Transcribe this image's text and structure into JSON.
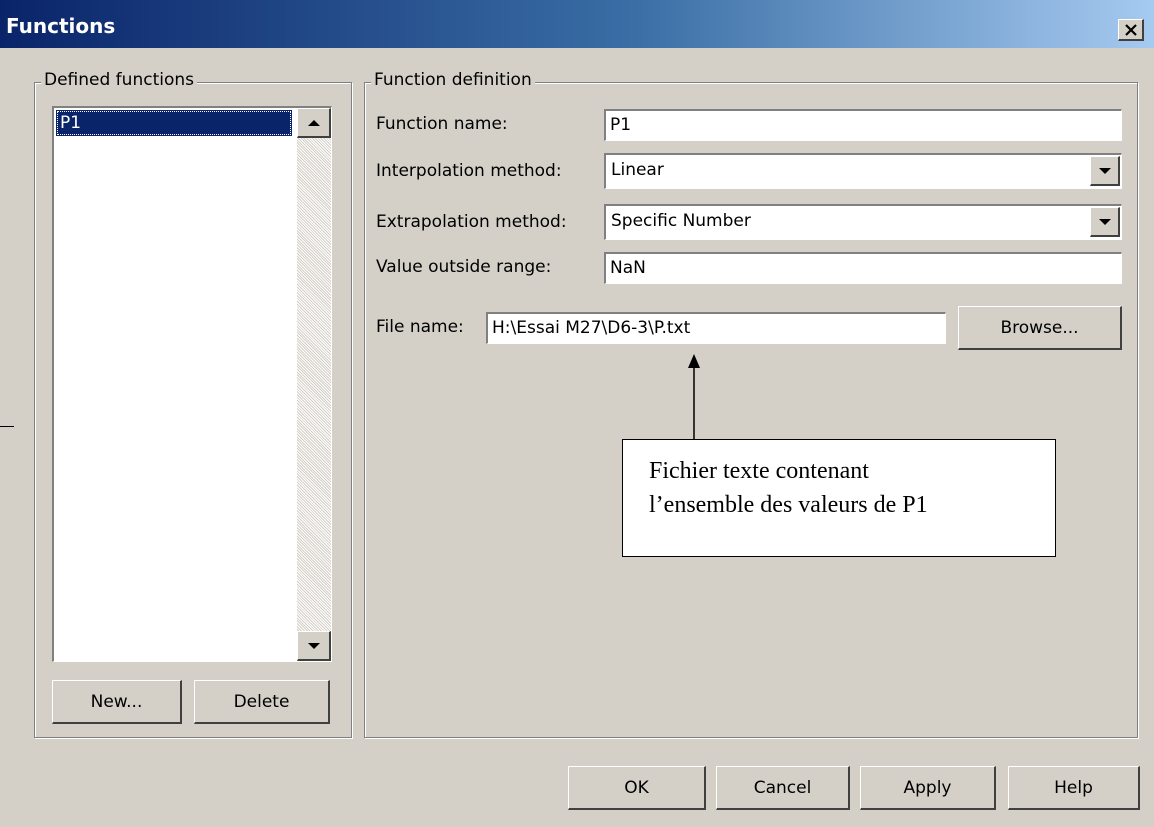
{
  "window": {
    "title": "Functions"
  },
  "defined_functions": {
    "legend": "Defined functions",
    "items": [
      "P1"
    ],
    "new_label": "New...",
    "delete_label": "Delete"
  },
  "function_definition": {
    "legend": "Function definition",
    "function_name_label": "Function name:",
    "function_name_value": "P1",
    "interpolation_label": "Interpolation method:",
    "interpolation_value": "Linear",
    "extrapolation_label": "Extrapolation method:",
    "extrapolation_value": "Specific Number",
    "value_outside_label": "Value outside range:",
    "value_outside_value": "NaN",
    "file_name_label": "File name:",
    "file_name_value": "H:\\Essai M27\\D6-3\\P.txt",
    "browse_label": "Browse..."
  },
  "annotation": {
    "line1": "Fichier texte contenant",
    "line2": "l’ensemble des valeurs de P1"
  },
  "footer": {
    "ok_label": "OK",
    "cancel_label": "Cancel",
    "apply_label": "Apply",
    "help_label": "Help"
  },
  "colors": {
    "face": "#d4d0c8",
    "titlebar_start": "#0a246a",
    "titlebar_end": "#a6caf0",
    "selection": "#0a246a"
  },
  "icons": [
    "close-icon",
    "scroll-up-arrow-icon",
    "scroll-down-arrow-icon",
    "dropdown-arrow-icon",
    "annotation-arrow-icon"
  ]
}
